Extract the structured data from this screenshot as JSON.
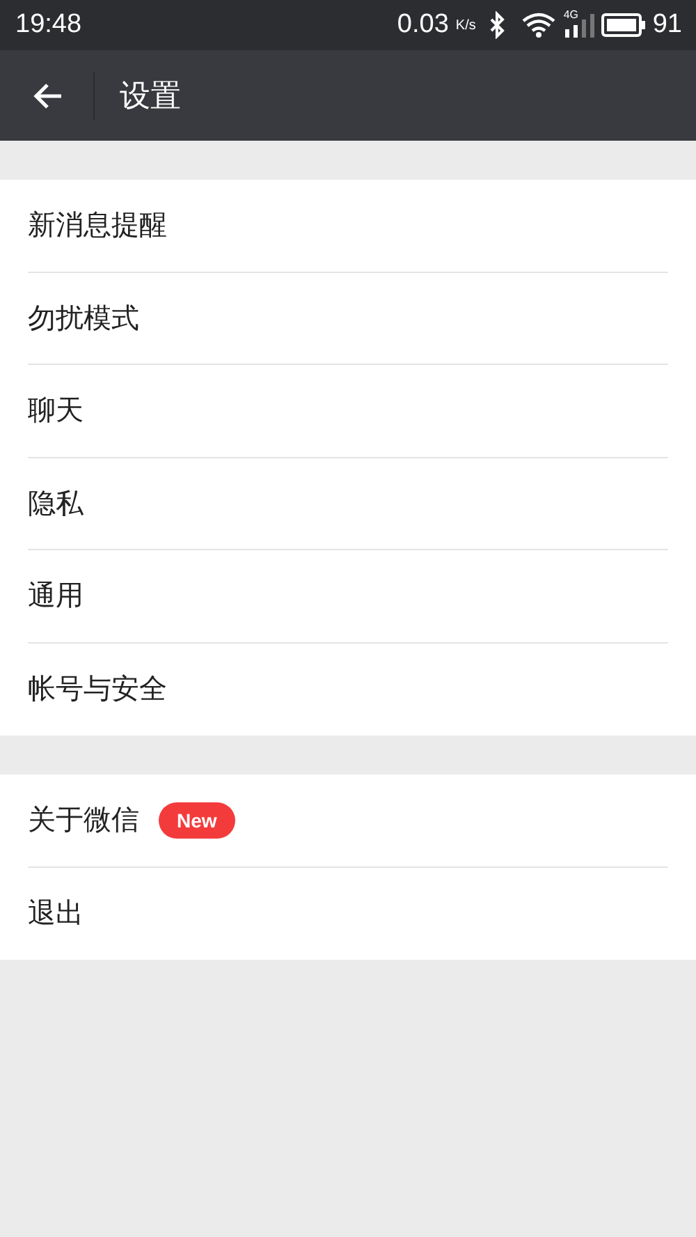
{
  "status_bar": {
    "time": "19:48",
    "speed": "0.03",
    "speed_unit": "K/s",
    "network": "4G",
    "battery": "91"
  },
  "header": {
    "title": "设置"
  },
  "groups": [
    {
      "items": [
        {
          "label": "新消息提醒"
        },
        {
          "label": "勿扰模式"
        },
        {
          "label": "聊天"
        },
        {
          "label": "隐私"
        },
        {
          "label": "通用"
        },
        {
          "label": "帐号与安全"
        }
      ]
    },
    {
      "items": [
        {
          "label": "关于微信",
          "badge": "New"
        },
        {
          "label": "退出"
        }
      ]
    }
  ]
}
